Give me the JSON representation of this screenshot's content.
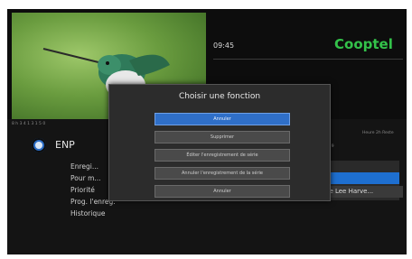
{
  "header": {
    "time": "09:45",
    "brand": "Cooptel",
    "subline": "8 h 3 4 1 3 1 5 0"
  },
  "channel": {
    "name": "ENP"
  },
  "menu": {
    "items": [
      "Enregi...",
      "Pour m...",
      "Priorité",
      "Prog. l'enreg.",
      "Historique"
    ]
  },
  "right_panel": {
    "info": "Heure 2h Reste",
    "number": "1/ 9",
    "list_text": "de Lee Harve..."
  },
  "dialog": {
    "title": "Choisir une fonction",
    "options": [
      {
        "label": "Annuler",
        "active": true
      },
      {
        "label": "Supprimer",
        "active": false
      },
      {
        "label": "Éditer l'enregistrement de série",
        "active": false
      },
      {
        "label": "Annuler l'enregistrement de la série",
        "active": false
      },
      {
        "label": "Annuler",
        "active": false
      }
    ]
  },
  "colors": {
    "accent": "#2f6fc8",
    "brand_green": "#33c24a",
    "background": "#141414"
  }
}
